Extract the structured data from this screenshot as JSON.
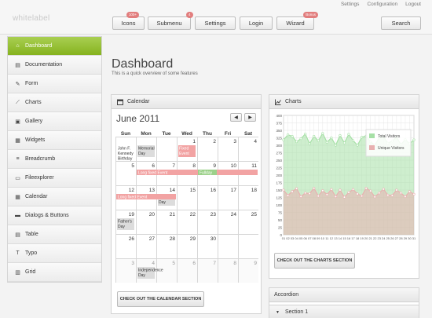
{
  "top_links": [
    "Settings",
    "Configuration",
    "Logout"
  ],
  "logo": "whitelabel",
  "nav": {
    "icons": {
      "label": "Icons",
      "badge": "100+"
    },
    "submenu": {
      "label": "Submenu",
      "badge": "4"
    },
    "settings": {
      "label": "Settings"
    },
    "login": {
      "label": "Login"
    },
    "wizard": {
      "label": "Wizard",
      "badge": "Bonus"
    },
    "search": {
      "label": "Search"
    }
  },
  "sidebar": [
    {
      "label": "Dashboard",
      "icon": "home-icon",
      "active": true
    },
    {
      "label": "Documentation",
      "icon": "book-icon"
    },
    {
      "label": "Form",
      "icon": "edit-icon"
    },
    {
      "label": "Charts",
      "icon": "chart-icon"
    },
    {
      "label": "Gallery",
      "icon": "gallery-icon"
    },
    {
      "label": "Widgets",
      "icon": "widgets-icon"
    },
    {
      "label": "Breadcrumb",
      "icon": "breadcrumb-icon"
    },
    {
      "label": "Fileexplorer",
      "icon": "folder-icon"
    },
    {
      "label": "Calendar",
      "icon": "calendar-icon"
    },
    {
      "label": "Dialogs & Buttons",
      "icon": "dialog-icon"
    },
    {
      "label": "Table",
      "icon": "table-icon"
    },
    {
      "label": "Typo",
      "icon": "typo-icon"
    },
    {
      "label": "Grid",
      "icon": "grid-icon"
    }
  ],
  "page": {
    "title": "Dashboard",
    "subtitle": "This is a quick overview of some features"
  },
  "calendar": {
    "heading": "Calendar",
    "month": "June 2011",
    "days": [
      "Sun",
      "Mon",
      "Tue",
      "Wed",
      "Thu",
      "Fri",
      "Sat"
    ],
    "weeks": [
      [
        "",
        "",
        "",
        "1",
        "2",
        "3",
        "4"
      ],
      [
        "5",
        "6",
        "7",
        "8",
        "9",
        "10",
        "11"
      ],
      [
        "12",
        "13",
        "14",
        "15",
        "16",
        "17",
        "18"
      ],
      [
        "19",
        "20",
        "21",
        "22",
        "23",
        "24",
        "25"
      ],
      [
        "26",
        "27",
        "28",
        "29",
        "30",
        "",
        ""
      ],
      [
        "3",
        "4",
        "5",
        "6",
        "7",
        "8",
        "9"
      ]
    ],
    "cell_events": [
      {
        "week": 0,
        "day": 0,
        "text": "John F. Kennedy Birthday",
        "style": "plain"
      },
      {
        "week": 0,
        "day": 1,
        "text": "Memorial Day",
        "style": "gray"
      },
      {
        "week": 0,
        "day": 3,
        "text": "Fixed Event",
        "style": "red"
      },
      {
        "week": 2,
        "day": 2,
        "text": "Flag Day",
        "style": "gray"
      },
      {
        "week": 3,
        "day": 0,
        "text": "Father's Day",
        "style": "gray"
      },
      {
        "week": 5,
        "day": 1,
        "text": "Independence Day",
        "style": "gray"
      }
    ],
    "bar_events": [
      {
        "week": 1,
        "from": 1,
        "to": 6,
        "text": "Long fixed Event",
        "style": "red"
      },
      {
        "week": 1,
        "from": 4,
        "to": 4,
        "text": "Fullday",
        "style": "green"
      },
      {
        "week": 2,
        "from": 0,
        "to": 2,
        "text": "Long fixed Event",
        "style": "red"
      }
    ],
    "button": "CHECK OUT THE CALENDAR SECTION"
  },
  "charts_panel": {
    "heading": "Charts",
    "button": "CHECK OUT THE CHARTS SECTION"
  },
  "chart_data": {
    "type": "area",
    "x": [
      1,
      2,
      3,
      4,
      5,
      6,
      7,
      8,
      9,
      10,
      11,
      12,
      13,
      14,
      15,
      16,
      17,
      18,
      19,
      20,
      21,
      22,
      23,
      24,
      25,
      26,
      27,
      28,
      29,
      30,
      31
    ],
    "xticks": [
      "01",
      "02",
      "03",
      "04",
      "05",
      "06",
      "07",
      "08",
      "09",
      "10",
      "11",
      "12",
      "13",
      "14",
      "15",
      "16",
      "17",
      "18",
      "19",
      "20",
      "21",
      "22",
      "23",
      "24",
      "25",
      "26",
      "27",
      "28",
      "29",
      "30",
      "31"
    ],
    "ylim": [
      0,
      400
    ],
    "yticks": [
      0,
      25,
      50,
      75,
      100,
      125,
      150,
      175,
      200,
      225,
      250,
      275,
      300,
      325,
      350,
      375,
      400
    ],
    "grid": true,
    "legend_position": "top-right",
    "series": [
      {
        "name": "Total Visitors",
        "color": "#a6e0a6",
        "values": [
          318,
          335,
          330,
          312,
          322,
          338,
          305,
          330,
          315,
          340,
          310,
          325,
          300,
          333,
          308,
          337,
          316,
          300,
          327,
          331,
          312,
          300,
          325,
          329,
          307,
          314,
          328,
          302,
          319,
          305,
          318
        ]
      },
      {
        "name": "Unique Visitors",
        "color": "#e8b0b0",
        "values": [
          150,
          132,
          145,
          155,
          128,
          140,
          138,
          156,
          130,
          148,
          135,
          152,
          128,
          150,
          126,
          142,
          152,
          137,
          130,
          156,
          147,
          127,
          140,
          153,
          133,
          132,
          150,
          140,
          128,
          145,
          136
        ]
      }
    ]
  },
  "accordion": {
    "heading": "Accordion",
    "items": [
      "Section 1"
    ]
  }
}
